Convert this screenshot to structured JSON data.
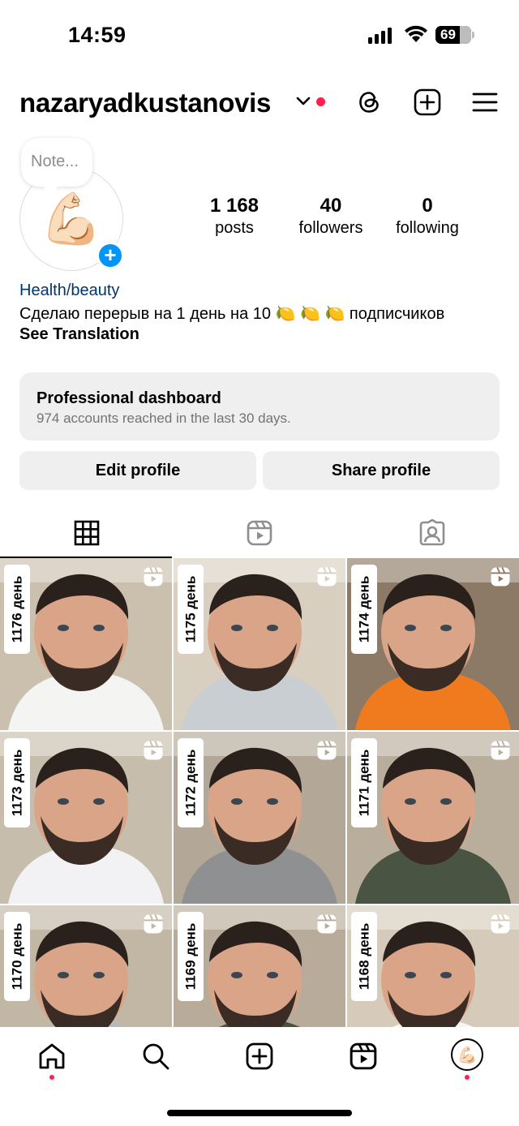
{
  "status_bar": {
    "time": "14:59",
    "battery": "69"
  },
  "header": {
    "username": "nazaryadkustanovis"
  },
  "profile": {
    "note_placeholder": "Note...",
    "avatar_emoji": "💪🏻",
    "stats": [
      {
        "value": "1 168",
        "label": "posts"
      },
      {
        "value": "40",
        "label": "followers"
      },
      {
        "value": "0",
        "label": "following"
      }
    ],
    "category": "Health/beauty",
    "bio": "Сделаю перерыв на 1 день на 10 🍋 🍋 🍋 подписчиков",
    "see_translation": "See Translation"
  },
  "dashboard": {
    "title": "Professional dashboard",
    "subtitle": "974 accounts reached in the last 30 days."
  },
  "buttons": {
    "edit": "Edit profile",
    "share": "Share profile"
  },
  "posts": [
    {
      "label": "1176 день",
      "bg": "#cbbfae",
      "shirt": "#f4f4f2"
    },
    {
      "label": "1175 день",
      "bg": "#d9cfc0",
      "shirt": "#c9ced2"
    },
    {
      "label": "1174 день",
      "bg": "#8d7a66",
      "shirt": "#f07a1e"
    },
    {
      "label": "1173 день",
      "bg": "#c7bdad",
      "shirt": "#f2f2f4"
    },
    {
      "label": "1172 день",
      "bg": "#b3a897",
      "shirt": "#8f9092"
    },
    {
      "label": "1171 день",
      "bg": "#b9ad9b",
      "shirt": "#4a5443"
    },
    {
      "label": "1170 день",
      "bg": "#c2b6a5",
      "shirt": "#b8b9bb"
    },
    {
      "label": "1169 день",
      "bg": "#b8ab99",
      "shirt": "#4b5045"
    },
    {
      "label": "1168 день",
      "bg": "#d6cbbb",
      "shirt": "#f4f5f7"
    }
  ],
  "colors": {
    "accent": "#0095f6",
    "notification": "#ff1f4b",
    "skin": "#d9a487",
    "beard": "#3a2c25"
  }
}
